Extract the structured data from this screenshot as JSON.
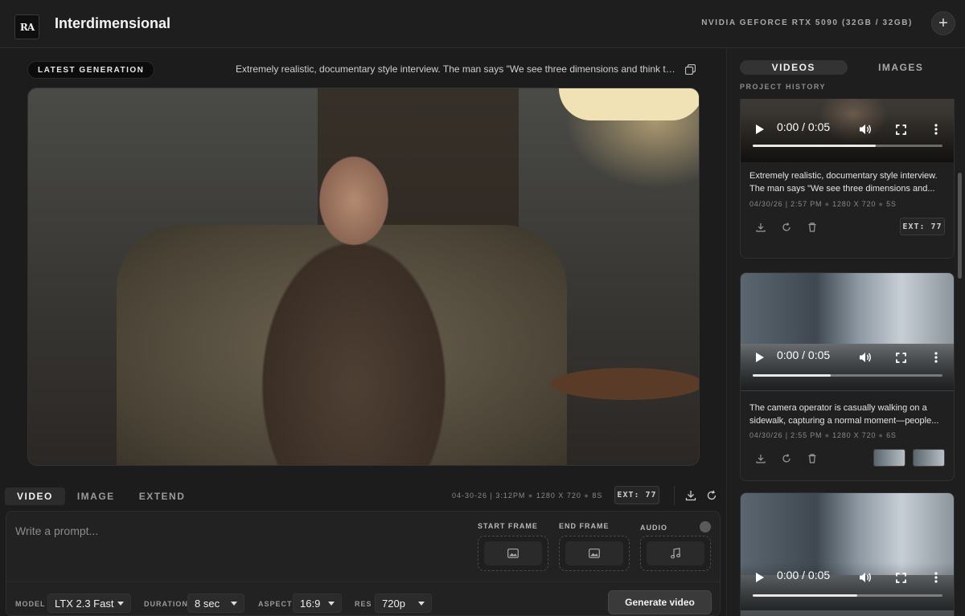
{
  "header": {
    "logo_text": "RA",
    "app_title": "Interdimensional",
    "gpu_label": "NVIDIA GEFORCE RTX 5090 (32GB / 32GB)",
    "add_icon": "plus-icon"
  },
  "latest": {
    "badge": "LATEST GENERATION",
    "prompt_preview": "Extremely realistic, documentary style interview. The man says \"We see three dimensions and think th...",
    "copy_icon": "copy-icon"
  },
  "mode_tabs": [
    {
      "label": "VIDEO",
      "active": true
    },
    {
      "label": "IMAGE",
      "active": false
    },
    {
      "label": "EXTEND",
      "active": false
    }
  ],
  "generation_meta": {
    "date": "04-30-26 | 3:12PM",
    "resolution": "1280 X 720",
    "duration": "8S",
    "ext_label": "EXT: 77"
  },
  "prompt": {
    "placeholder": "Write a prompt...",
    "value": "",
    "start_frame_label": "START FRAME",
    "end_frame_label": "END FRAME",
    "audio_label": "AUDIO"
  },
  "options": {
    "model_label": "MODEL",
    "model_value": "LTX 2.3 Fast",
    "duration_label": "DURATION",
    "duration_value": "8 sec",
    "aspect_label": "ASPECT",
    "aspect_value": "16:9",
    "res_label": "RES",
    "res_value": "720p",
    "generate_label": "Generate video"
  },
  "side": {
    "tabs": [
      {
        "label": "VIDEOS",
        "active": true
      },
      {
        "label": "IMAGES",
        "active": false
      }
    ],
    "history_label": "PROJECT HISTORY",
    "cards": [
      {
        "time": "0:00 / 0:05",
        "progress": 0.65,
        "desc_line1": "Extremely realistic, documentary style interview.",
        "desc_line2": "The man says \"We see three dimensions and...",
        "date": "04/30/26 | 2:57 PM",
        "resolution": "1280 X 720",
        "duration": "5S",
        "ext_label": "EXT: 77"
      },
      {
        "time": "0:00 / 0:05",
        "progress": 0.41,
        "desc_line1": "The camera operator is casually walking on a",
        "desc_line2": "sidewalk, capturing a normal moment—people...",
        "date": "04/30/26 | 2:55 PM",
        "resolution": "1280 X 720",
        "duration": "6S"
      },
      {
        "time": "0:00 / 0:05",
        "progress": 0.55
      }
    ]
  },
  "colors": {
    "background": "#1c1c1c",
    "panel": "#222222",
    "accent": "#3a3a3a",
    "text": "#e8e8e8"
  }
}
